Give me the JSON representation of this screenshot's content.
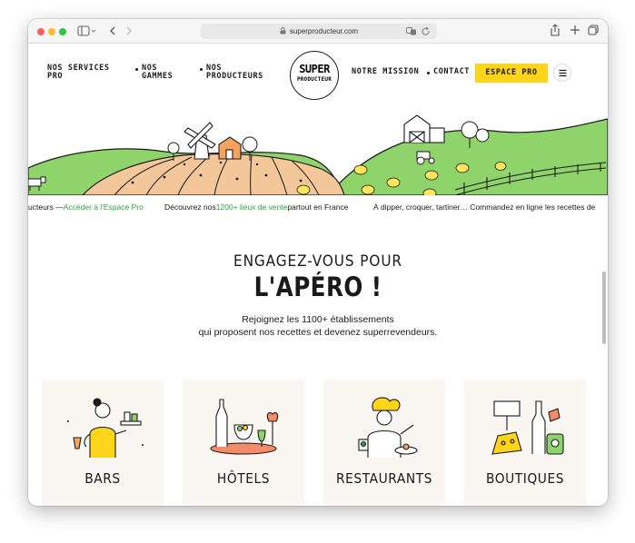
{
  "browser": {
    "url": "superproducteur.com"
  },
  "header": {
    "nav_services": "NOS SERVICES PRO",
    "nav_gammes": "NOS GAMMES",
    "nav_producteurs": "NOS PRODUCTEURS",
    "logo_top": "SUPER",
    "logo_bottom": "PRODUCTEUR",
    "nav_mission": "NOTRE MISSION",
    "nav_contact": "CONTACT",
    "pro_button": "ESPACE PRO"
  },
  "ticker": {
    "item1_prefix": "ucteurs — ",
    "item1_link": "Accéder à l'Espace Pro",
    "item2_prefix": "Découvrez nos ",
    "item2_highlight": "1200+ lieux de vente",
    "item2_suffix": " partout en France",
    "item3": "À dipper, croquer, tartiner… Commandez en ligne les recettes de"
  },
  "section": {
    "title_line1": "ENGAGEZ-VOUS POUR",
    "title_line2": "L'APÉRO !",
    "subtitle_line1": "Rejoignez les 1100+ établissements",
    "subtitle_line2": "qui proposent nos recettes et devenez superrevendeurs."
  },
  "cards": [
    {
      "title": "BARS",
      "icon": "waitress-icon"
    },
    {
      "title": "HÔTELS",
      "icon": "wine-tray-icon"
    },
    {
      "title": "RESTAURANTS",
      "icon": "chef-icon"
    },
    {
      "title": "BOUTIQUES",
      "icon": "shop-products-icon"
    }
  ],
  "colors": {
    "accent_yellow": "#ffd51c",
    "hill_green": "#8fd36b",
    "field_tan": "#f3c79a",
    "link_green": "#2fa53a"
  }
}
